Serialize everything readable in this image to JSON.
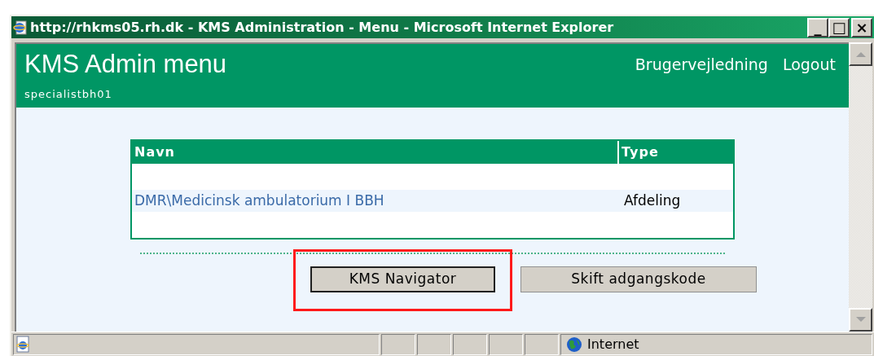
{
  "window": {
    "title": "http://rhkms05.rh.dk - KMS Administration - Menu - Microsoft Internet Explorer",
    "controls": [
      "_",
      "□",
      "×"
    ]
  },
  "header": {
    "title": "KMS Admin menu",
    "user": "specialistbh01",
    "links": [
      "Brugervejledning",
      "Logout"
    ]
  },
  "table": {
    "columns": [
      "Navn",
      "Type"
    ],
    "rows": [
      {
        "name": "DMR\\Medicinsk ambulatorium I BBH",
        "type": "Afdeling"
      }
    ]
  },
  "buttons": [
    {
      "label": "KMS Navigator",
      "highlighted": true
    },
    {
      "label": "Skift adgangskode",
      "highlighted": false
    }
  ],
  "status_bar": {
    "zone": "Internet"
  }
}
